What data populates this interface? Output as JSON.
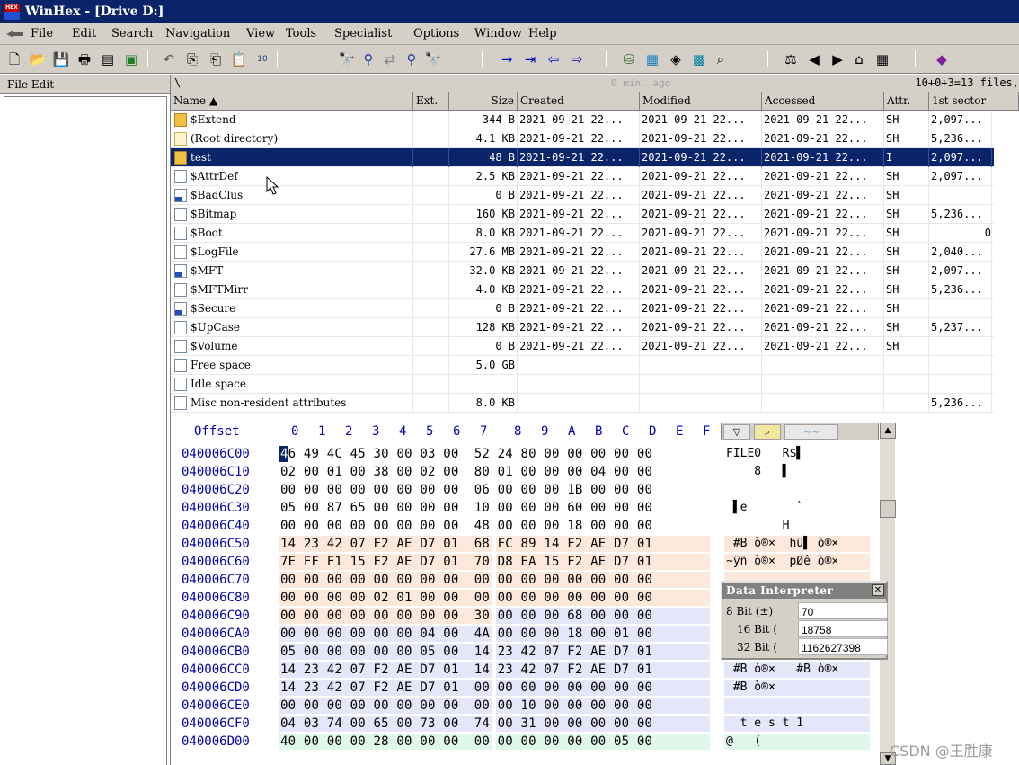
{
  "window": {
    "title": "WinHex - [Drive D:]",
    "logo_text": "HEX"
  },
  "menu": [
    "File",
    "Edit",
    "Search",
    "Navigation",
    "View",
    "Tools",
    "Specialist",
    "Options",
    "Window",
    "Help"
  ],
  "left_panel": {
    "header": "File Edit"
  },
  "path_bar": {
    "path": "\\",
    "status": "0 min. ago",
    "count": "10+0+3=13 files,"
  },
  "file_list": {
    "columns": [
      "Name ▲",
      "Ext.",
      "Size",
      "Created",
      "Modified",
      "Accessed",
      "Attr.",
      "1st sector"
    ],
    "rows": [
      {
        "name": "$Extend",
        "ext": "",
        "size": "344 B",
        "created": "2021-09-21  22...",
        "modified": "2021-09-21  22...",
        "accessed": "2021-09-21  22...",
        "attr": "SH",
        "sector": "2,097...",
        "icon": "folder"
      },
      {
        "name": "(Root directory)",
        "ext": "",
        "size": "4.1 KB",
        "created": "2021-09-21  22...",
        "modified": "2021-09-21  22...",
        "accessed": "2021-09-21  22...",
        "attr": "SH",
        "sector": "5,236...",
        "icon": "root"
      },
      {
        "name": "test",
        "ext": "",
        "size": "48 B",
        "created": "2021-09-21  22...",
        "modified": "2021-09-21  22...",
        "accessed": "2021-09-21  22...",
        "attr": "I",
        "sector": "2,097...",
        "icon": "folder",
        "selected": true
      },
      {
        "name": "$AttrDef",
        "ext": "",
        "size": "2.5 KB",
        "created": "2021-09-21  22...",
        "modified": "2021-09-21  22...",
        "accessed": "2021-09-21  22...",
        "attr": "SH",
        "sector": "2,097...",
        "icon": "file"
      },
      {
        "name": "$BadClus",
        "ext": "",
        "size": "0 B",
        "created": "2021-09-21  22...",
        "modified": "2021-09-21  22...",
        "accessed": "2021-09-21  22...",
        "attr": "SH",
        "sector": "",
        "icon": "sys"
      },
      {
        "name": "$Bitmap",
        "ext": "",
        "size": "160 KB",
        "created": "2021-09-21  22...",
        "modified": "2021-09-21  22...",
        "accessed": "2021-09-21  22...",
        "attr": "SH",
        "sector": "5,236...",
        "icon": "file"
      },
      {
        "name": "$Boot",
        "ext": "",
        "size": "8.0 KB",
        "created": "2021-09-21  22...",
        "modified": "2021-09-21  22...",
        "accessed": "2021-09-21  22...",
        "attr": "SH",
        "sector": "0",
        "icon": "file"
      },
      {
        "name": "$LogFile",
        "ext": "",
        "size": "27.6 MB",
        "created": "2021-09-21  22...",
        "modified": "2021-09-21  22...",
        "accessed": "2021-09-21  22...",
        "attr": "SH",
        "sector": "2,040...",
        "icon": "file"
      },
      {
        "name": "$MFT",
        "ext": "",
        "size": "32.0 KB",
        "created": "2021-09-21  22...",
        "modified": "2021-09-21  22...",
        "accessed": "2021-09-21  22...",
        "attr": "SH",
        "sector": "2,097...",
        "icon": "sys"
      },
      {
        "name": "$MFTMirr",
        "ext": "",
        "size": "4.0 KB",
        "created": "2021-09-21  22...",
        "modified": "2021-09-21  22...",
        "accessed": "2021-09-21  22...",
        "attr": "SH",
        "sector": "5,236...",
        "icon": "file"
      },
      {
        "name": "$Secure",
        "ext": "",
        "size": "0 B",
        "created": "2021-09-21  22...",
        "modified": "2021-09-21  22...",
        "accessed": "2021-09-21  22...",
        "attr": "SH",
        "sector": "",
        "icon": "sys"
      },
      {
        "name": "$UpCase",
        "ext": "",
        "size": "128 KB",
        "created": "2021-09-21  22...",
        "modified": "2021-09-21  22...",
        "accessed": "2021-09-21  22...",
        "attr": "SH",
        "sector": "5,237...",
        "icon": "file"
      },
      {
        "name": "$Volume",
        "ext": "",
        "size": "0 B",
        "created": "2021-09-21  22...",
        "modified": "2021-09-21  22...",
        "accessed": "2021-09-21  22...",
        "attr": "SH",
        "sector": "",
        "icon": "file"
      },
      {
        "name": "Free space",
        "ext": "",
        "size": "5.0 GB",
        "created": "",
        "modified": "",
        "accessed": "",
        "attr": "",
        "sector": "",
        "icon": "file"
      },
      {
        "name": "Idle space",
        "ext": "",
        "size": "",
        "created": "",
        "modified": "",
        "accessed": "",
        "attr": "",
        "sector": "",
        "icon": "file"
      },
      {
        "name": "Misc non-resident attributes",
        "ext": "",
        "size": "8.0 KB",
        "created": "",
        "modified": "",
        "accessed": "",
        "attr": "",
        "sector": "5,236...",
        "icon": "file"
      }
    ]
  },
  "hex": {
    "offset_label": "Offset",
    "column_labels": [
      "0",
      "1",
      "2",
      "3",
      "4",
      "5",
      "6",
      "7",
      "8",
      "9",
      "A",
      "B",
      "C",
      "D",
      "E",
      "F"
    ],
    "rows": [
      {
        "offset": "040006C00",
        "bytes": "46 49 4C 45 30 00 03 00  52 24 80 00 00 00 00 00",
        "ascii": "FILE0   R$▌",
        "band": "white"
      },
      {
        "offset": "040006C10",
        "bytes": "02 00 01 00 38 00 02 00  80 01 00 00 00 04 00 00",
        "ascii": "    8   ▌",
        "band": "white"
      },
      {
        "offset": "040006C20",
        "bytes": "00 00 00 00 00 00 00 00  06 00 00 00 1B 00 00 00",
        "ascii": "",
        "band": "white"
      },
      {
        "offset": "040006C30",
        "bytes": "05 00 87 65 00 00 00 00  10 00 00 00 60 00 00 00",
        "ascii": " ▌e       `",
        "band": "white"
      },
      {
        "offset": "040006C40",
        "bytes": "00 00 00 00 00 00 00 00  48 00 00 00 18 00 00 00",
        "ascii": "        H",
        "band": "white"
      },
      {
        "offset": "040006C50",
        "bytes": "14 23 42 07 F2 AE D7 01  68 FC 89 14 F2 AE D7 01",
        "ascii": " #B ò®×  hü▌ ò®×",
        "band": "peach"
      },
      {
        "offset": "040006C60",
        "bytes": "7E FF F1 15 F2 AE D7 01  70 D8 EA 15 F2 AE D7 01",
        "ascii": "~ÿñ ò®×  pØê ò®×",
        "band": "peach"
      },
      {
        "offset": "040006C70",
        "bytes": "00 00 00 00 00 00 00 00  00 00 00 00 00 00 00 00",
        "ascii": "",
        "band": "peach"
      },
      {
        "offset": "040006C80",
        "bytes": "00 00 00 00 02 01 00 00  00 00 00 00 00 00 00 00",
        "ascii": "",
        "band": "peach"
      },
      {
        "offset": "040006C90",
        "bytes": "00 00 00 00 00 00 00 00  30 00 00 00 68 00 00 00",
        "ascii": "",
        "band": "split"
      },
      {
        "offset": "040006CA0",
        "bytes": "00 00 00 00 00 00 04 00  4A 00 00 00 18 00 01 00",
        "ascii": "",
        "band": "lav"
      },
      {
        "offset": "040006CB0",
        "bytes": "05 00 00 00 00 00 05 00  14 23 42 07 F2 AE D7 01",
        "ascii": "",
        "band": "lav"
      },
      {
        "offset": "040006CC0",
        "bytes": "14 23 42 07 F2 AE D7 01  14 23 42 07 F2 AE D7 01",
        "ascii": " #B ò®×   #B ò®×",
        "band": "lav"
      },
      {
        "offset": "040006CD0",
        "bytes": "14 23 42 07 F2 AE D7 01  00 00 00 00 00 00 00 00",
        "ascii": " #B ò®×",
        "band": "lav"
      },
      {
        "offset": "040006CE0",
        "bytes": "00 00 00 00 00 00 00 00  00 00 10 00 00 00 00 00",
        "ascii": "",
        "band": "lav"
      },
      {
        "offset": "040006CF0",
        "bytes": "04 03 74 00 65 00 73 00  74 00 31 00 00 00 00 00",
        "ascii": "  t e s t 1",
        "band": "lav"
      },
      {
        "offset": "040006D00",
        "bytes": "40 00 00 00 28 00 00 00  00 00 00 00 00 00 05 00",
        "ascii": "@   (",
        "band": "mint"
      }
    ]
  },
  "data_interpreter": {
    "title": "Data Interpreter",
    "close": "✕",
    "rows": [
      {
        "label": "8 Bit (±)",
        "value": "70"
      },
      {
        "label": "16 Bit (",
        "value": "18758"
      },
      {
        "label": "32 Bit (",
        "value": "1162627398"
      }
    ]
  },
  "watermark": "CSDN @王胜康",
  "colors": {
    "title_bg": "#0a246a",
    "selection": "#0a246a",
    "offset_blue": "#0000b0",
    "band_peach": "#fde8dc",
    "band_lav": "#e6e6fa",
    "band_mint": "#e0f8ec"
  }
}
